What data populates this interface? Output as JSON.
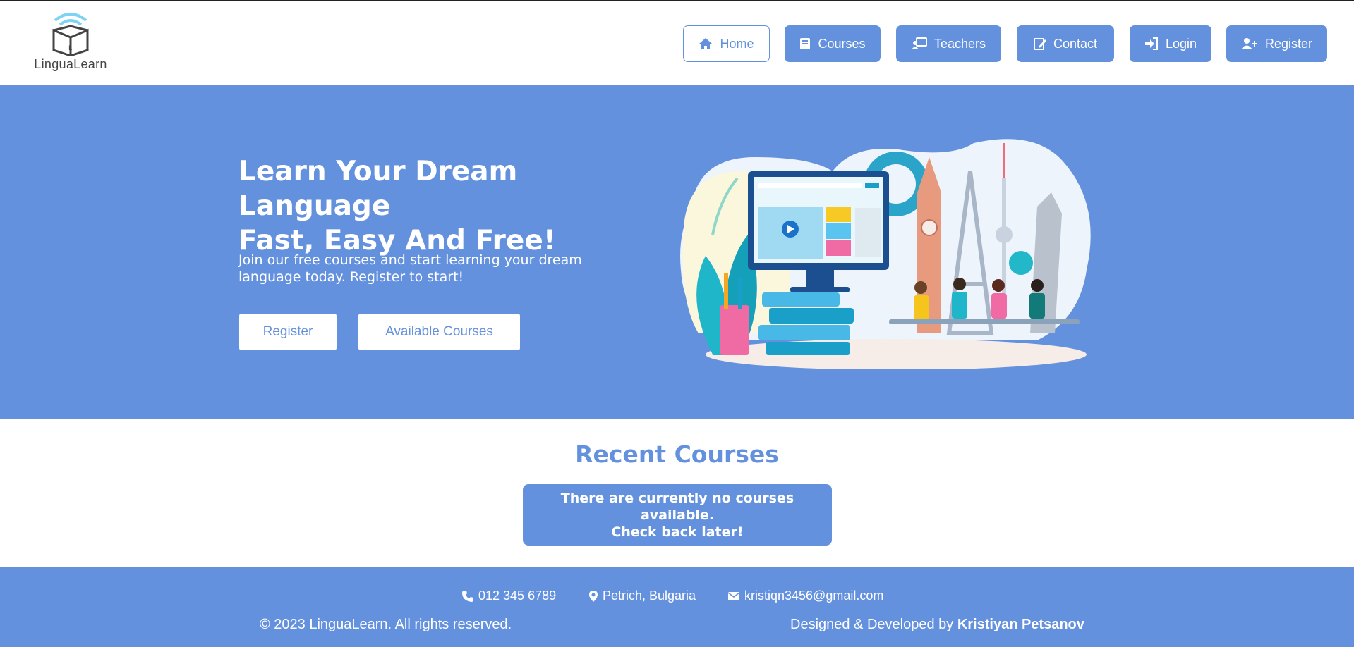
{
  "header": {
    "logo_text": "LinguaLearn",
    "nav": [
      {
        "label": "Home",
        "icon": "home-icon",
        "active": true
      },
      {
        "label": "Courses",
        "icon": "book-icon"
      },
      {
        "label": "Teachers",
        "icon": "teacher-icon"
      },
      {
        "label": "Contact",
        "icon": "contact-icon"
      },
      {
        "label": "Login",
        "icon": "login-icon"
      },
      {
        "label": "Register",
        "icon": "user-plus-icon"
      }
    ]
  },
  "hero": {
    "title_line1": "Learn Your Dream Language",
    "title_line2": "Fast, Easy And Free!",
    "subtitle": "Join our free courses and start learning your dream language today. Register to start!",
    "register_label": "Register",
    "courses_label": "Available Courses"
  },
  "recent": {
    "title": "Recent Courses",
    "notice_line1": "There are currently no courses available.",
    "notice_line2": "Check back later!"
  },
  "footer": {
    "phone": "012 345 6789",
    "location": "Petrich, Bulgaria",
    "email": "kristiqn3456@gmail.com",
    "copyright": "© 2023 LinguaLearn. All rights reserved.",
    "credit_prefix": "Designed & Developed by",
    "credit_name": "Kristiyan Petsanov"
  },
  "colors": {
    "brand": "#6491de",
    "white": "#ffffff"
  }
}
